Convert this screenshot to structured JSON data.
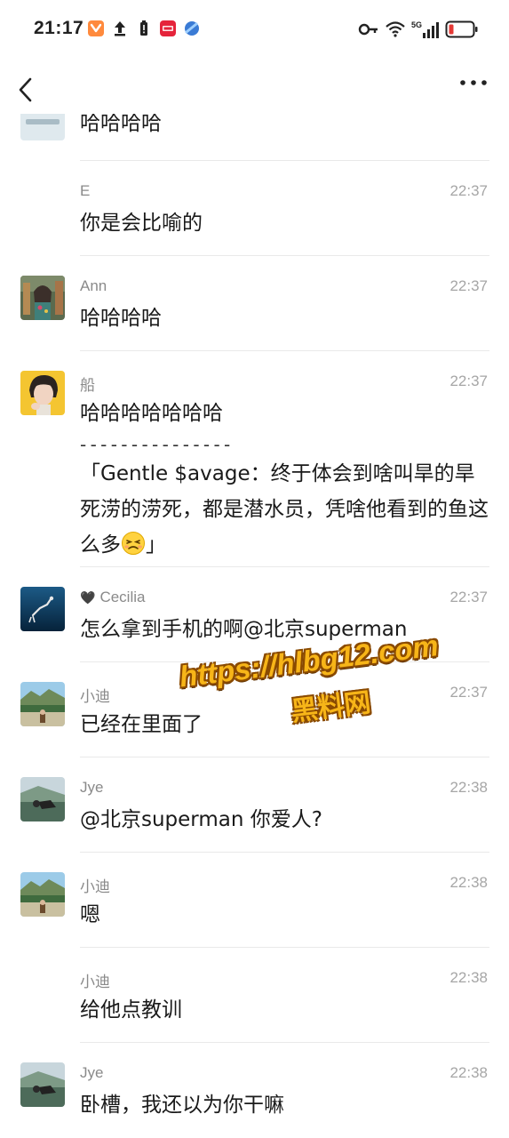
{
  "status_bar": {
    "time": "21:17",
    "left_icons": [
      "shield-app-icon",
      "upload-icon",
      "battery-saver-icon",
      "news-app-icon",
      "browser-app-icon"
    ],
    "right_icons": [
      "key-icon",
      "wifi-icon",
      "signal-5g-icon",
      "battery-low-icon"
    ],
    "network": "5G",
    "battery_color": "#e53935"
  },
  "nav": {
    "back_icon": "chevron-left-icon",
    "more_icon": "more-dots-icon"
  },
  "messages": [
    {
      "sender": "",
      "time": "",
      "text": "哈哈哈哈",
      "avatar": "avatar-partial"
    },
    {
      "sender": "E",
      "time": "22:37",
      "text": "你是会比喻的",
      "avatar": ""
    },
    {
      "sender": "Ann",
      "time": "22:37",
      "text": "哈哈哈哈",
      "avatar": "avatar-ann"
    },
    {
      "sender": "船",
      "time": "22:37",
      "text": "哈哈哈哈哈哈哈",
      "quote_line": "- - - - - - - - - - - - - - -",
      "quote": "「Gentle $avage：终于体会到啥叫旱的旱死涝的涝死，都是潜水员，凭啥他看到的鱼这么多",
      "quote_end": "」",
      "avatar": "avatar-chuan"
    },
    {
      "sender": "Cecilia",
      "sender_prefix": "🖤",
      "time": "22:37",
      "text": "怎么拿到手机的啊@北京superman",
      "avatar": "avatar-cecilia"
    },
    {
      "sender": "小迪",
      "time": "22:37",
      "text": "已经在里面了",
      "avatar": "avatar-xiaodi"
    },
    {
      "sender": "Jye",
      "time": "22:38",
      "text": "@北京superman 你爱人?",
      "avatar": "avatar-jye"
    },
    {
      "sender": "小迪",
      "time": "22:38",
      "text": "嗯",
      "avatar": "avatar-xiaodi"
    },
    {
      "sender": "小迪",
      "time": "22:38",
      "text": "给他点教训",
      "avatar": ""
    },
    {
      "sender": "Jye",
      "time": "22:38",
      "text": "卧槽，我还以为你干嘛",
      "avatar": "avatar-jye"
    }
  ],
  "watermark": {
    "url": "https://hlbg12.com",
    "label": "黑料网",
    "color": "#f7b518"
  }
}
